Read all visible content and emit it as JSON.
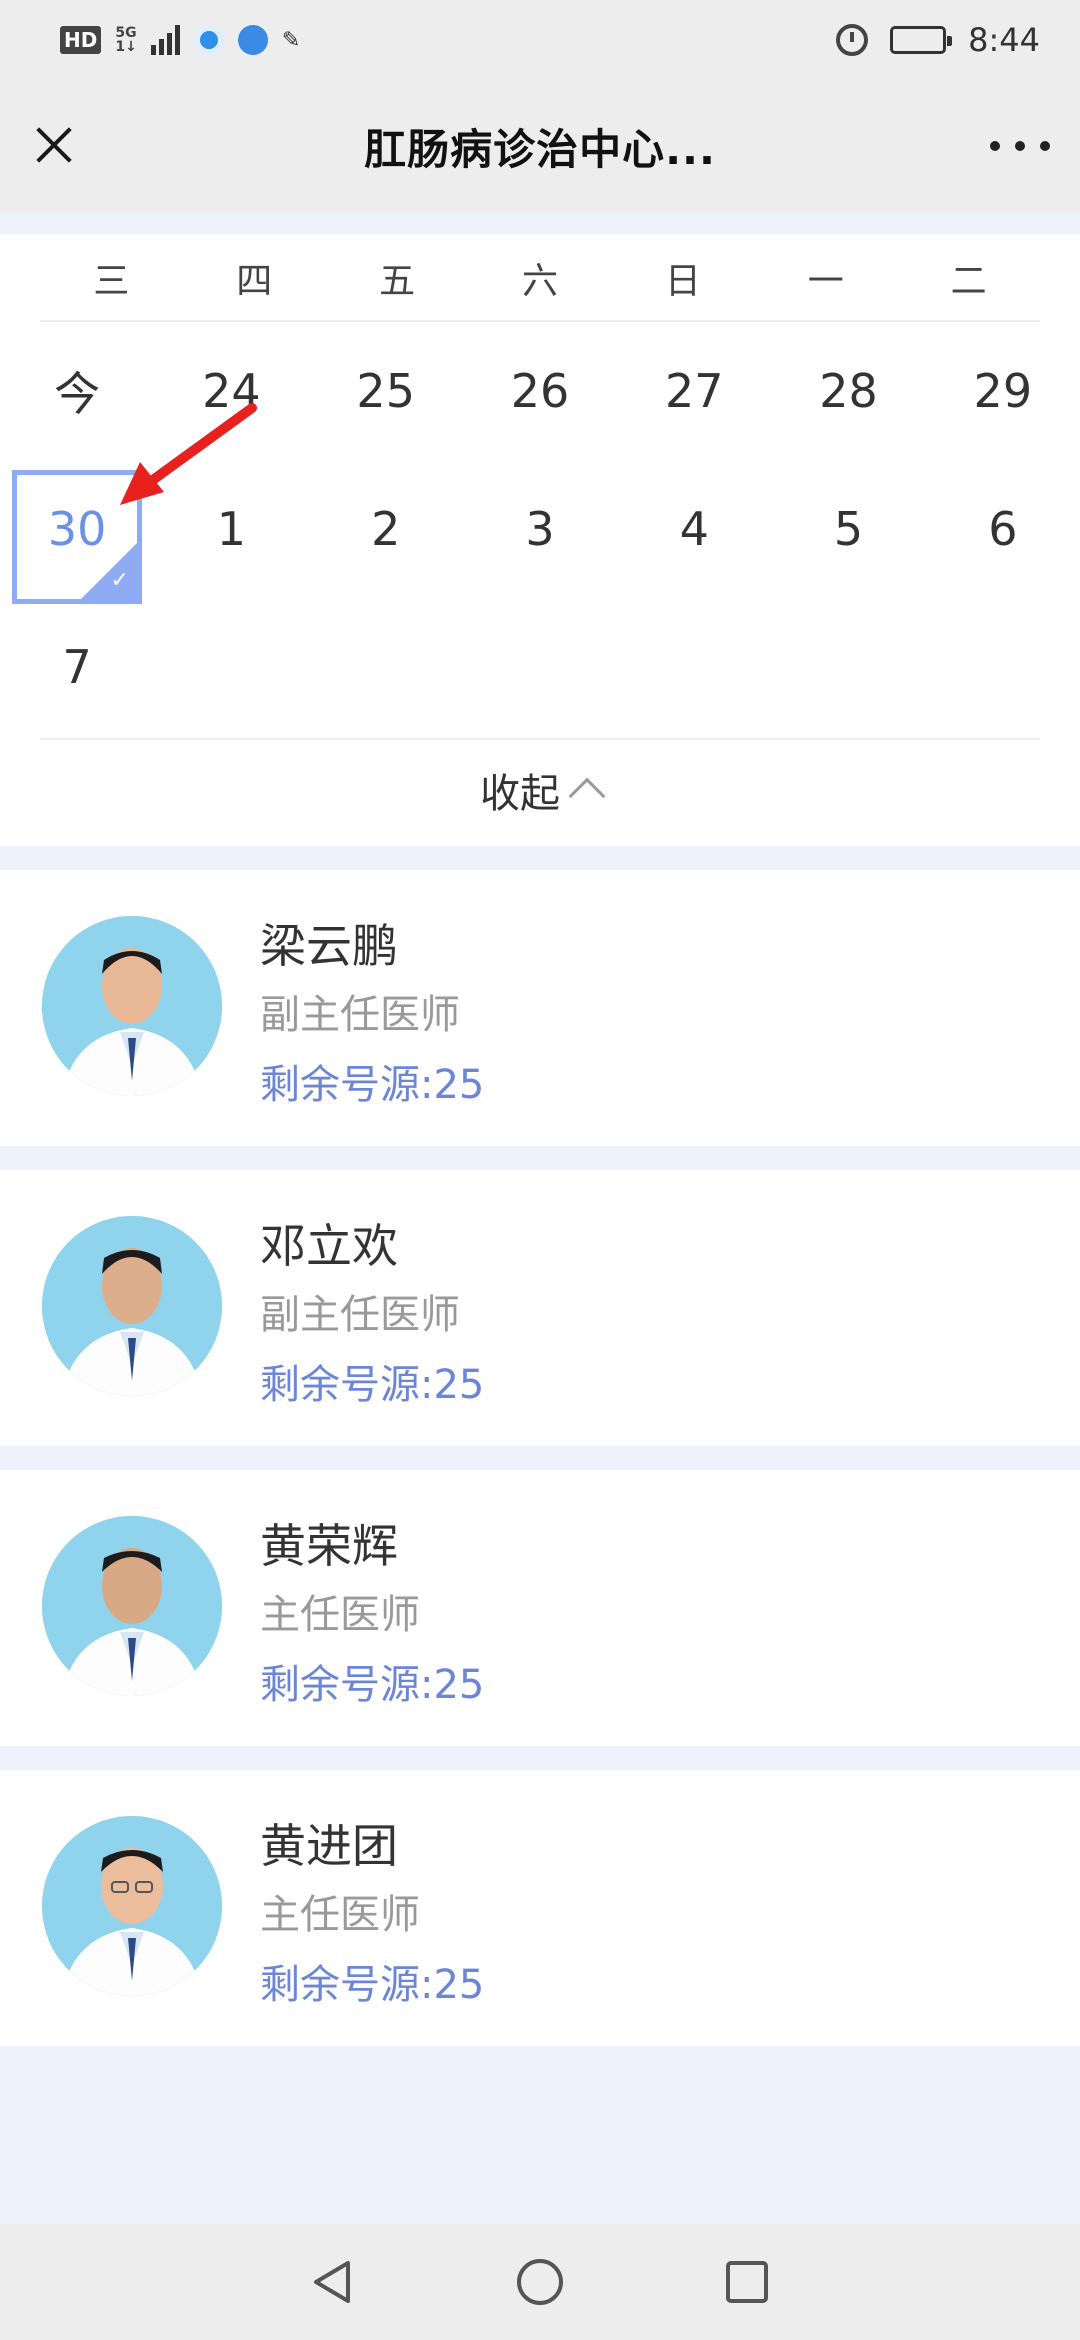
{
  "status_bar": {
    "hd_label": "HD",
    "network_label": "5G",
    "network_sub": "1↓",
    "time": "8:44"
  },
  "header": {
    "title": "肛肠病诊治中心...",
    "close_icon": "close-icon",
    "more_icon": "more-icon"
  },
  "calendar": {
    "weekdays": [
      "三",
      "四",
      "五",
      "六",
      "日",
      "一",
      "二"
    ],
    "rows": [
      [
        "今",
        "24",
        "25",
        "26",
        "27",
        "28",
        "29"
      ],
      [
        "30",
        "1",
        "2",
        "3",
        "4",
        "5",
        "6"
      ],
      [
        "7",
        "",
        "",
        "",
        "",
        "",
        ""
      ]
    ],
    "selected_date": "30",
    "collapse_label": "收起",
    "accent_color": "#8fabf4",
    "annotation_color": "#e8201e"
  },
  "doctors": [
    {
      "name": "梁云鹏",
      "title": "副主任医师",
      "slots": "剩余号源:25"
    },
    {
      "name": "邓立欢",
      "title": "副主任医师",
      "slots": "剩余号源:25"
    },
    {
      "name": "黄荣辉",
      "title": "主任医师",
      "slots": "剩余号源:25"
    },
    {
      "name": "黄进团",
      "title": "主任医师",
      "slots": "剩余号源:25"
    }
  ],
  "colors": {
    "slots_text": "#6c86d6",
    "page_background": "#eef2fb"
  }
}
